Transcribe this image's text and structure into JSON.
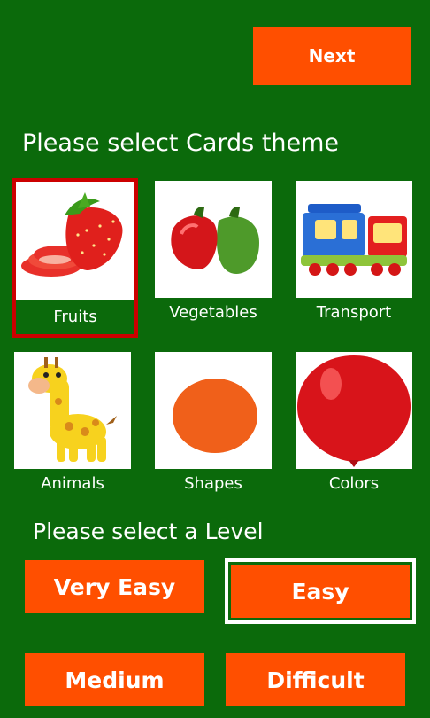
{
  "header": {
    "next_label": "Next"
  },
  "theme_section": {
    "title": "Please select Cards theme",
    "selected": "Fruits",
    "cards": [
      {
        "label": "Fruits",
        "icon": "strawberry-icon"
      },
      {
        "label": "Vegetables",
        "icon": "bell-peppers-icon"
      },
      {
        "label": "Transport",
        "icon": "toy-train-icon"
      },
      {
        "label": "Animals",
        "icon": "giraffe-icon"
      },
      {
        "label": "Shapes",
        "icon": "orange-circle-icon"
      },
      {
        "label": "Colors",
        "icon": "red-balloon-icon"
      }
    ]
  },
  "level_section": {
    "title": "Please select a Level",
    "selected": "Easy",
    "levels": [
      "Very Easy",
      "Easy",
      "Medium",
      "Difficult"
    ]
  },
  "colors": {
    "background": "#0b6a0b",
    "button": "#ff4f00",
    "selected_border": "#cc0000"
  }
}
